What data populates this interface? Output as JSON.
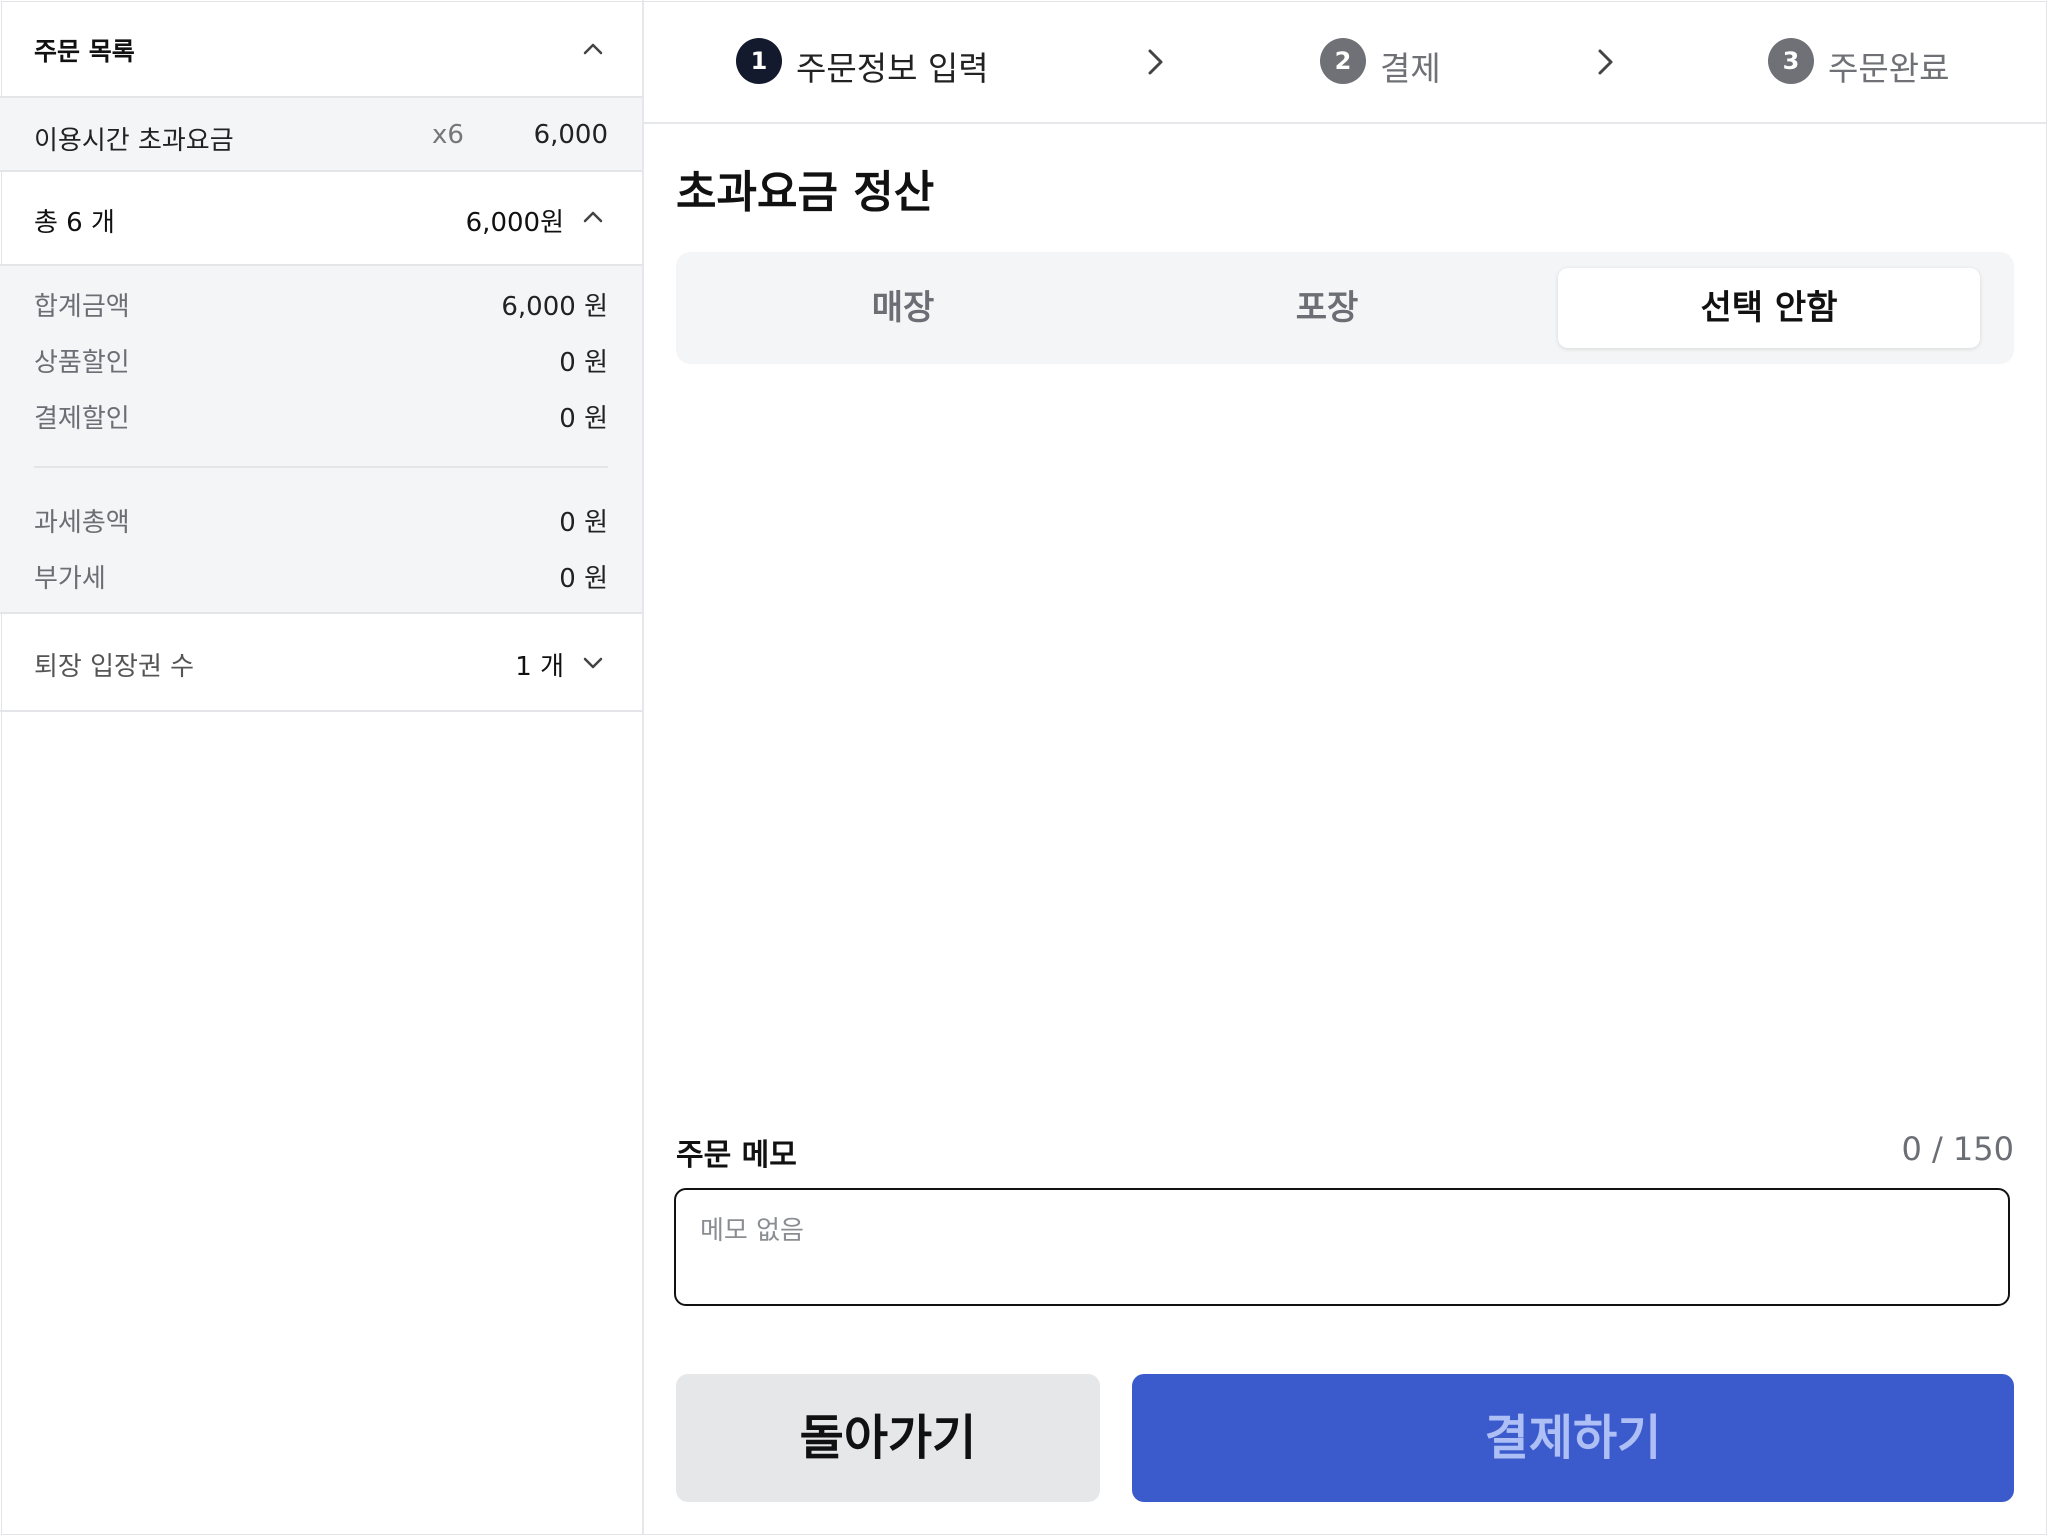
{
  "order_list": {
    "title": "주문 목록",
    "items": [
      {
        "name": "이용시간 초과요금",
        "qty": "x6",
        "price": "6,000"
      }
    ],
    "total_label": "총 6 개",
    "total_amount": "6,000원",
    "details": [
      {
        "label": "합계금액",
        "value": "6,000 원"
      },
      {
        "label": "상품할인",
        "value": "0 원"
      },
      {
        "label": "결제할인",
        "value": "0 원"
      }
    ],
    "tax": [
      {
        "label": "과세총액",
        "value": "0 원"
      },
      {
        "label": "부가세",
        "value": "0 원"
      }
    ],
    "exit_tickets_label": "퇴장 입장권 수",
    "exit_tickets_value": "1 개"
  },
  "steps": [
    {
      "num": "1",
      "label": "주문정보 입력",
      "active": true
    },
    {
      "num": "2",
      "label": "결제",
      "active": false
    },
    {
      "num": "3",
      "label": "주문완료",
      "active": false
    }
  ],
  "page_title": "초과요금 정산",
  "segments": [
    "매장",
    "포장",
    "선택 안함"
  ],
  "selected_segment": "선택 안함",
  "memo": {
    "label": "주문 메모",
    "count": "0 / 150",
    "placeholder": "메모 없음",
    "value": ""
  },
  "buttons": {
    "back": "돌아가기",
    "pay": "결제하기"
  },
  "colors": {
    "accent": "#3b5bcc",
    "step_active": "#141a2e",
    "step_inactive": "#6f7176"
  }
}
